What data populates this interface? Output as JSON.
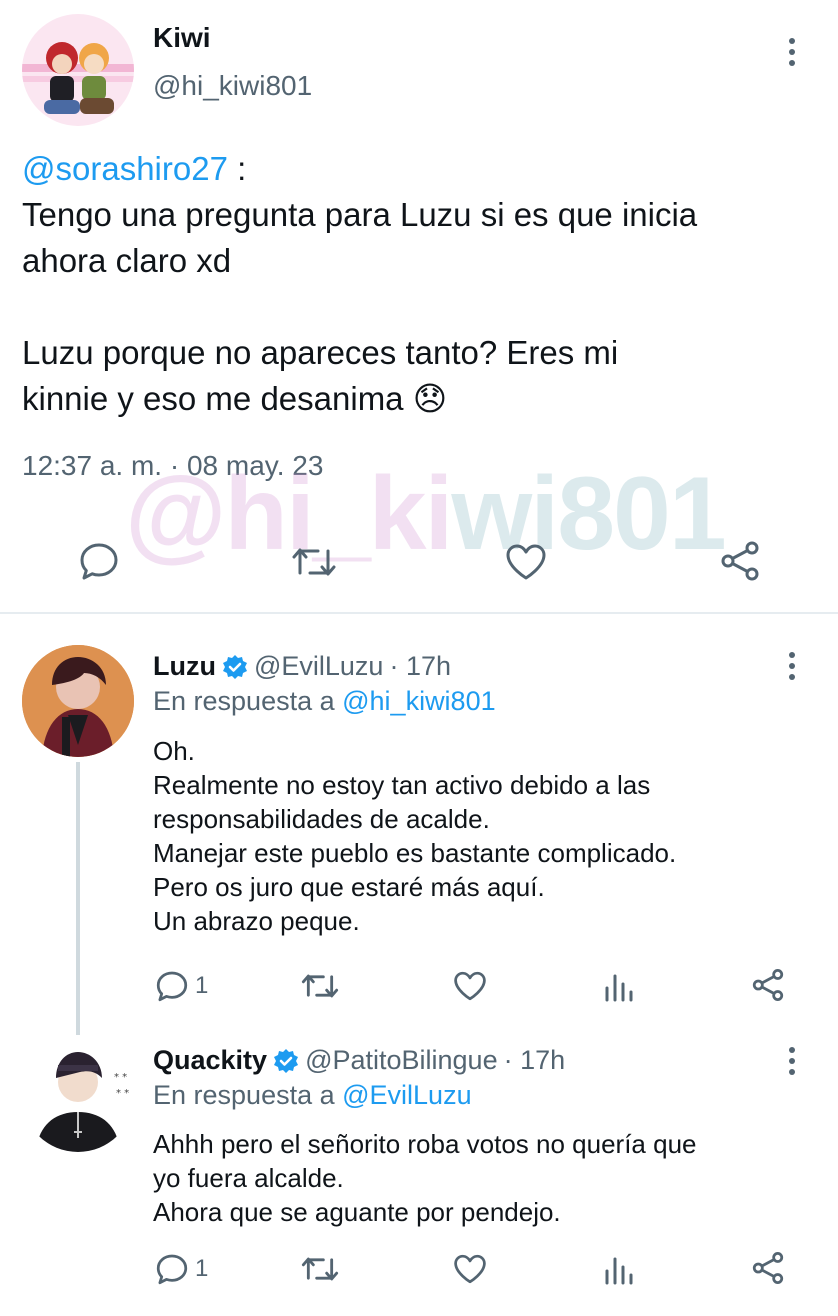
{
  "main_tweet": {
    "display_name": "Kiwi",
    "handle": "@hi_kiwi801",
    "mention": "@sorashiro27",
    "mention_suffix": " :",
    "body": "Tengo una pregunta para Luzu si es que inicia\nahora claro xd\n\nLuzu porque no apareces tanto? Eres mi\nkinnie y eso me desanima",
    "emoji": "😞",
    "timestamp": "12:37 a. m. · 08 may. 23"
  },
  "watermark": {
    "text_a": "@hi_ki",
    "text_b": "wi801"
  },
  "replies": [
    {
      "display_name": "Luzu",
      "verified": true,
      "handle": "@EvilLuzu",
      "time": "· 17h",
      "reply_prefix": "En respuesta a ",
      "reply_to": "@hi_kiwi801",
      "body": "Oh.\nRealmente no estoy tan activo debido a las\nresponsabilidades de acalde.\nManejar este pueblo es bastante complicado.\nPero os juro que estaré más aquí.\nUn abrazo peque.",
      "reply_count": "1"
    },
    {
      "display_name": "Quackity",
      "verified": true,
      "handle": "@PatitoBilingue",
      "time": "· 17h",
      "reply_prefix": "En respuesta a ",
      "reply_to": "@EvilLuzu",
      "body": "Ahhh pero el señorito roba votos no quería que\nyo fuera alcalde.\nAhora que se aguante por pendejo.",
      "reply_count": "1"
    }
  ],
  "colors": {
    "accent": "#1d9bf0",
    "muted": "#536471",
    "divider": "#e6ecf0",
    "verified": "#1d9bf0"
  }
}
